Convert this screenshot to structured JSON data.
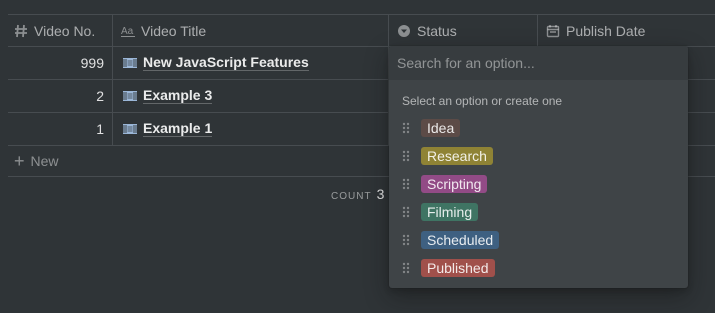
{
  "table": {
    "columns": [
      {
        "label": "Video No.",
        "icon": "hash-icon"
      },
      {
        "label": "Video Title",
        "icon": "text-aa-icon"
      },
      {
        "label": "Status",
        "icon": "select-icon"
      },
      {
        "label": "Publish Date",
        "icon": "calendar-icon"
      }
    ],
    "rows": [
      {
        "no": "999",
        "title": "New JavaScript Features"
      },
      {
        "no": "2",
        "title": "Example 3"
      },
      {
        "no": "1",
        "title": "Example 1"
      }
    ],
    "new_label": "New",
    "count_label": "COUNT",
    "count_value": "3"
  },
  "status_dropdown": {
    "search_placeholder": "Search for an option...",
    "hint": "Select an option or create one",
    "options": [
      {
        "label": "Idea",
        "color": "#5c4b47"
      },
      {
        "label": "Research",
        "color": "#8f8335"
      },
      {
        "label": "Scripting",
        "color": "#924b86"
      },
      {
        "label": "Filming",
        "color": "#3f7463"
      },
      {
        "label": "Scheduled",
        "color": "#3e6081"
      },
      {
        "label": "Published",
        "color": "#a0504b"
      }
    ]
  }
}
